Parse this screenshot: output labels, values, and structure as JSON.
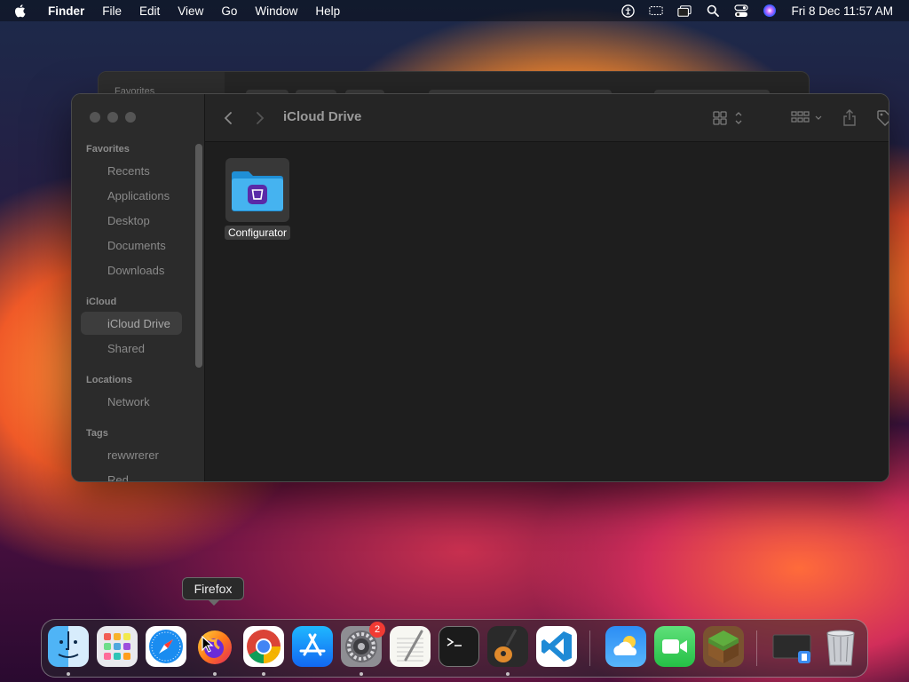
{
  "menubar": {
    "app_name": "Finder",
    "menus": [
      "File",
      "Edit",
      "View",
      "Go",
      "Window",
      "Help"
    ],
    "clock": "Fri 8 Dec  11:57 AM"
  },
  "background_window": {
    "favorites_label": "Favorites"
  },
  "finder": {
    "title": "iCloud Drive",
    "sidebar": {
      "sections": {
        "favorites": "Favorites",
        "icloud": "iCloud",
        "locations": "Locations",
        "tags": "Tags"
      },
      "favorites": [
        "Recents",
        "Applications",
        "Desktop",
        "Documents",
        "Downloads"
      ],
      "icloud": [
        "iCloud Drive",
        "Shared"
      ],
      "locations": [
        "Network"
      ],
      "tags": [
        "rewwrerer",
        "Red"
      ]
    },
    "files": [
      {
        "name": "Configurator",
        "icon": "folder-with-app-icon"
      }
    ]
  },
  "tooltip": "Firefox",
  "dock": {
    "apps": [
      "Finder",
      "Launchpad",
      "Safari",
      "Firefox",
      "Google Chrome",
      "App Store",
      "System Settings",
      "TextEdit",
      "Terminal",
      "GarageBand",
      "Visual Studio Code",
      "Weather",
      "FaceTime",
      "Minecraft",
      "Screen Sharing",
      "Trash"
    ],
    "badge": {
      "System Settings": "2"
    }
  },
  "colors": {
    "finder_bg": "#1e1e1e",
    "sidebar_bg": "#2b2b2b",
    "folder_blue": "#3aa8e8",
    "badge_red": "#f23a33"
  }
}
